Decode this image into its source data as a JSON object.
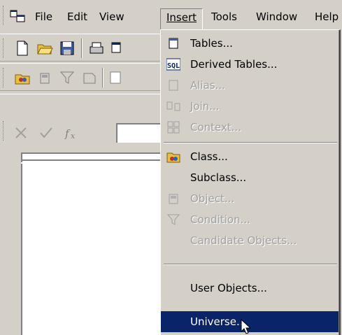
{
  "menubar": {
    "items": [
      {
        "label": "File"
      },
      {
        "label": "Edit"
      },
      {
        "label": "View"
      },
      {
        "label": "Insert"
      },
      {
        "label": "Tools"
      },
      {
        "label": "Window"
      },
      {
        "label": "Help"
      }
    ]
  },
  "toolbars": {
    "standard": [
      "new-document-icon",
      "open-folder-icon",
      "save-icon",
      "print-icon"
    ],
    "designer": [
      "class-icon",
      "object-icon",
      "condition-icon",
      "hierarchy-icon"
    ],
    "formula": [
      "cancel-icon",
      "accept-icon",
      "function-icon"
    ]
  },
  "insert_menu": {
    "items": [
      {
        "label": "Tables...",
        "icon": "tables-icon",
        "enabled": true
      },
      {
        "label": "Derived Tables...",
        "icon": "sql-icon",
        "enabled": true
      },
      {
        "label": "Alias...",
        "icon": "alias-icon",
        "enabled": false
      },
      {
        "label": "Join...",
        "icon": "join-icon",
        "enabled": false
      },
      {
        "label": "Context...",
        "icon": "context-icon",
        "enabled": false
      },
      {
        "label": "Class...",
        "icon": "class-icon",
        "enabled": true
      },
      {
        "label": "Subclass...",
        "icon": "",
        "enabled": true
      },
      {
        "label": "Object...",
        "icon": "object-icon",
        "enabled": false
      },
      {
        "label": "Condition...",
        "icon": "condition-icon",
        "enabled": false
      },
      {
        "label": "Candidate Objects...",
        "icon": "",
        "enabled": false
      },
      {
        "label": "User Objects...",
        "icon": "",
        "enabled": true
      },
      {
        "label": "Universe...",
        "icon": "",
        "enabled": true,
        "selected": true
      }
    ]
  },
  "colors": {
    "chrome": "#d4d0c8",
    "selection": "#0a246a",
    "disabled_text": "#a0a0a0"
  }
}
